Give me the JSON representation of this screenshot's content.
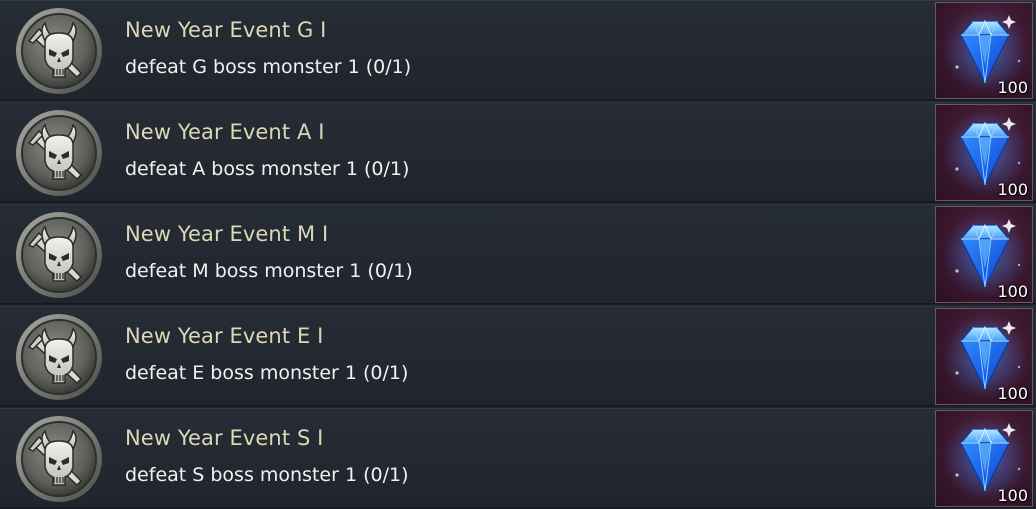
{
  "quests": [
    {
      "title": "New Year Event G I",
      "description": "defeat G boss monster 1 (0/1)",
      "reward_icon": "blue-diamond-icon",
      "reward_qty": "100"
    },
    {
      "title": "New Year Event A I",
      "description": "defeat A boss monster 1 (0/1)",
      "reward_icon": "blue-diamond-icon",
      "reward_qty": "100"
    },
    {
      "title": "New Year Event M I",
      "description": "defeat M boss monster 1 (0/1)",
      "reward_icon": "blue-diamond-icon",
      "reward_qty": "100"
    },
    {
      "title": "New Year Event E I",
      "description": "defeat E boss monster 1 (0/1)",
      "reward_icon": "blue-diamond-icon",
      "reward_qty": "100"
    },
    {
      "title": "New Year Event S I",
      "description": "defeat S boss monster 1 (0/1)",
      "reward_icon": "blue-diamond-icon",
      "reward_qty": "100"
    }
  ],
  "quest_icon": "demon-skull-sword-icon",
  "colors": {
    "title_text": "#ddd7b6",
    "description_text": "#f1f1f1",
    "row_background": "#262c35",
    "reward_background": "#3b1830",
    "diamond": "#2f8cff"
  }
}
